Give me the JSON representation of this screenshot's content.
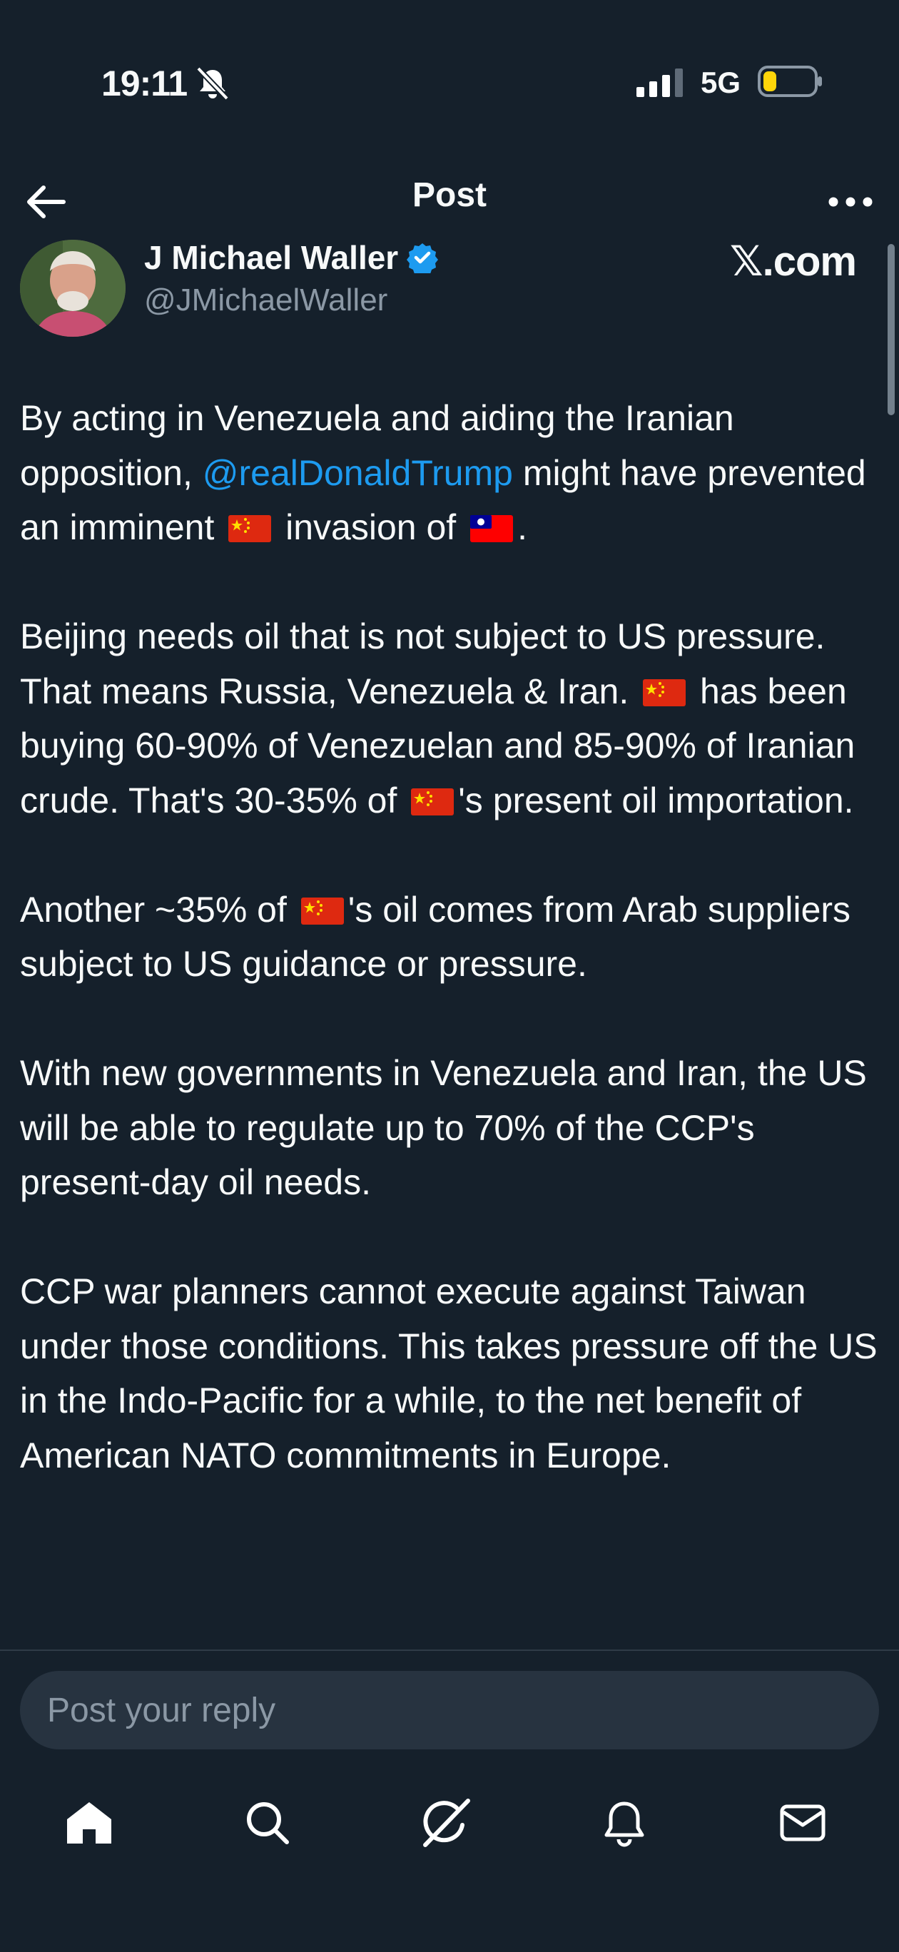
{
  "status_bar": {
    "time": "19:11",
    "network": "5G"
  },
  "header": {
    "title": "Post"
  },
  "author": {
    "name": "J Michael Waller",
    "handle": "@JMichaelWaller",
    "watermark": "𝕏.com",
    "verified_color": "#1d9bf0"
  },
  "post": {
    "p1": {
      "a": "By acting in Venezuela and aiding the Iranian opposition, ",
      "mention": "@realDonaldTrump",
      "b": " might have prevented an imminent ",
      "c": " invasion of ",
      "d": "."
    },
    "p2": {
      "a": "Beijing needs oil that is not subject to US pressure. That means Russia, Venezuela & Iran. ",
      "b": " has been buying 60-90% of Venezuelan and 85-90% of Iranian crude. That's 30-35% of ",
      "c": "'s present oil importation."
    },
    "p3": {
      "a": "Another ~35% of ",
      "b": "'s oil comes from Arab suppliers subject to US guidance or pressure."
    },
    "p4": "With new governments in Venezuela and Iran, the US will be able to regulate up to 70% of the CCP's present-day oil needs.",
    "p5": "CCP war planners cannot execute against Taiwan under those conditions. This takes pressure off the US in the Indo-Pacific for a while, to the net benefit of American NATO commitments in Europe."
  },
  "reply": {
    "placeholder": "Post your reply"
  },
  "icons": {
    "back": "arrow-left-icon",
    "more": "more-dots-icon",
    "verified": "verified-badge-icon",
    "flag_china": "flag-china-icon",
    "flag_taiwan": "flag-taiwan-icon",
    "home": "home-icon",
    "search": "search-icon",
    "grok": "grok-icon",
    "notifications": "bell-icon",
    "messages": "mail-icon"
  },
  "colors": {
    "background": "#15202b",
    "accent": "#1d9bf0",
    "muted": "#8b98a5"
  }
}
